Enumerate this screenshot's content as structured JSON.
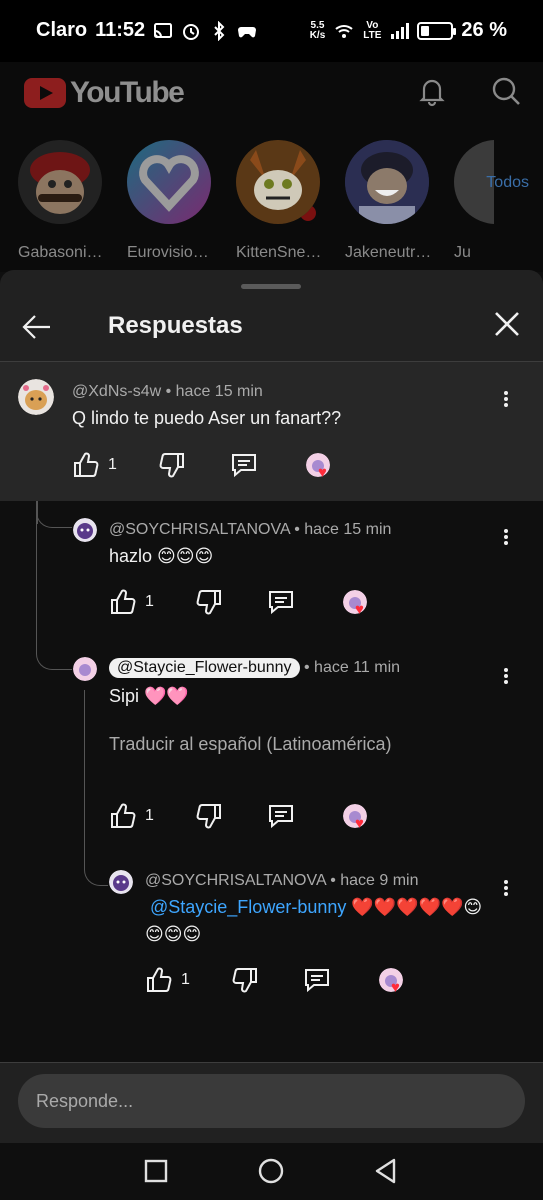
{
  "status_bar": {
    "carrier": "Claro",
    "time": "11:52",
    "net_speed_top": "5.5",
    "net_speed_bottom": "K/s",
    "volte_top": "Vo",
    "volte_bottom": "LTE",
    "battery": "26 %",
    "battery_level": 0.26
  },
  "youtube": {
    "wordmark": "YouTube",
    "channels": [
      {
        "name": "Gabasoni…"
      },
      {
        "name": "Eurovisio…"
      },
      {
        "name": "KittenSne…"
      },
      {
        "name": "Jakeneutr…"
      },
      {
        "name": "Ju"
      }
    ],
    "all_label": "Todos"
  },
  "sheet": {
    "title": "Respuestas",
    "reply_placeholder": "Responde..."
  },
  "comments": [
    {
      "handle": "@XdNs-s4w",
      "time": "hace 15 min",
      "text": "Q lindo te puedo Aser un fanart??",
      "likes": "1"
    },
    {
      "handle": "@SOYCHRISALTANOVA",
      "time": "hace 15 min",
      "text": "hazlo 😊😊😊",
      "likes": "1"
    },
    {
      "handle": "@Staycie_Flower-bunny",
      "time": "hace 11 min",
      "text": "Sipi 🩷🩷",
      "translate": "Traducir al español (Latinoamérica)",
      "likes": "1"
    },
    {
      "handle": "@SOYCHRISALTANOVA",
      "time": "hace 9 min",
      "mention": "@Staycie_Flower-bunny",
      "text_after": " ❤️❤️❤️❤️❤️😊",
      "text_line2": "😊😊😊",
      "likes": "1"
    }
  ],
  "colors": {
    "accent_link": "#3ea6ff",
    "heart": "#ff2b3a",
    "youtube_red_dimmed": "#8d1e1e"
  }
}
